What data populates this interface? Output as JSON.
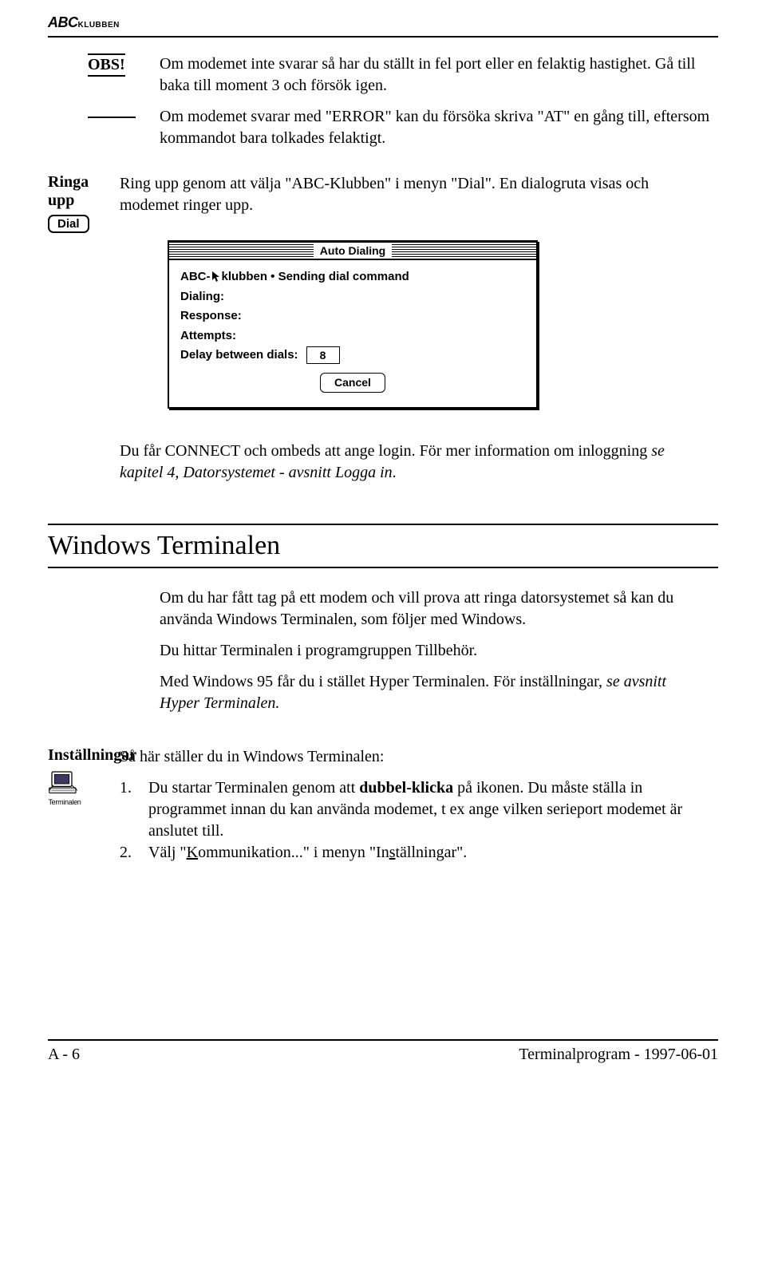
{
  "header": {
    "logo_abc": "ABC",
    "logo_klubben": "KLUBBEN"
  },
  "obs": {
    "label": "OBS!",
    "para1": "Om modemet inte svarar så har du ställt in fel port eller en felaktig hastighet. Gå till baka till moment 3 och försök igen.",
    "para2": "Om modemet svarar med \"ERROR\" kan du försöka skriva \"AT\" en gång till, eftersom kommandot bara tolkades felaktigt."
  },
  "ringa": {
    "label": "Ringa upp",
    "button": "Dial",
    "para": "Ring upp genom att välja \"ABC-Klubben\" i menyn \"Dial\". En dialogruta visas och modemet ringer upp."
  },
  "dialog": {
    "title": "Auto Dialing",
    "line1_pre": "ABC-",
    "line1_post": "klubben • Sending dial command",
    "dialing_lbl": "Dialing:",
    "response_lbl": "Response:",
    "attempts_lbl": "Attempts:",
    "delay_lbl": "Delay between dials:",
    "delay_val": "8",
    "cancel": "Cancel"
  },
  "connect": {
    "pre": "Du får CONNECT och ombeds att ange login. För mer information om inloggning ",
    "ital": "se kapitel 4, Datorsystemet - avsnitt Logga in",
    "post": "."
  },
  "winterm": {
    "title": "Windows Terminalen",
    "p1": "Om du har fått tag på ett modem och vill prova att ringa datorsystemet så kan du använda Windows Terminalen, som följer med Windows.",
    "p2": "Du hittar Terminalen i programgruppen Tillbehör.",
    "p3_pre": "Med Windows 95 får du i stället Hyper Terminalen. För inställningar, ",
    "p3_ital": "se avsnitt Hyper Terminalen."
  },
  "instal": {
    "label": "Inställningar",
    "icon_caption": "Terminalen",
    "intro": "Så här ställer du in Windows Terminalen:",
    "n1": "1.",
    "i1_pre": "Du startar Terminalen genom att ",
    "i1_bold": "dubbel-klicka",
    "i1_post": " på ikonen. Du måste ställa in programmet innan du kan använda modemet, t ex ange vilken serieport modemet är anslutet till.",
    "n2": "2.",
    "i2_pre": "Välj \"",
    "i2_k": "K",
    "i2_mid": "ommunikation...\" i menyn \"In",
    "i2_s": "s",
    "i2_post": "tällningar\"."
  },
  "footer": {
    "left": "A - 6",
    "right": "Terminalprogram - 1997-06-01"
  }
}
